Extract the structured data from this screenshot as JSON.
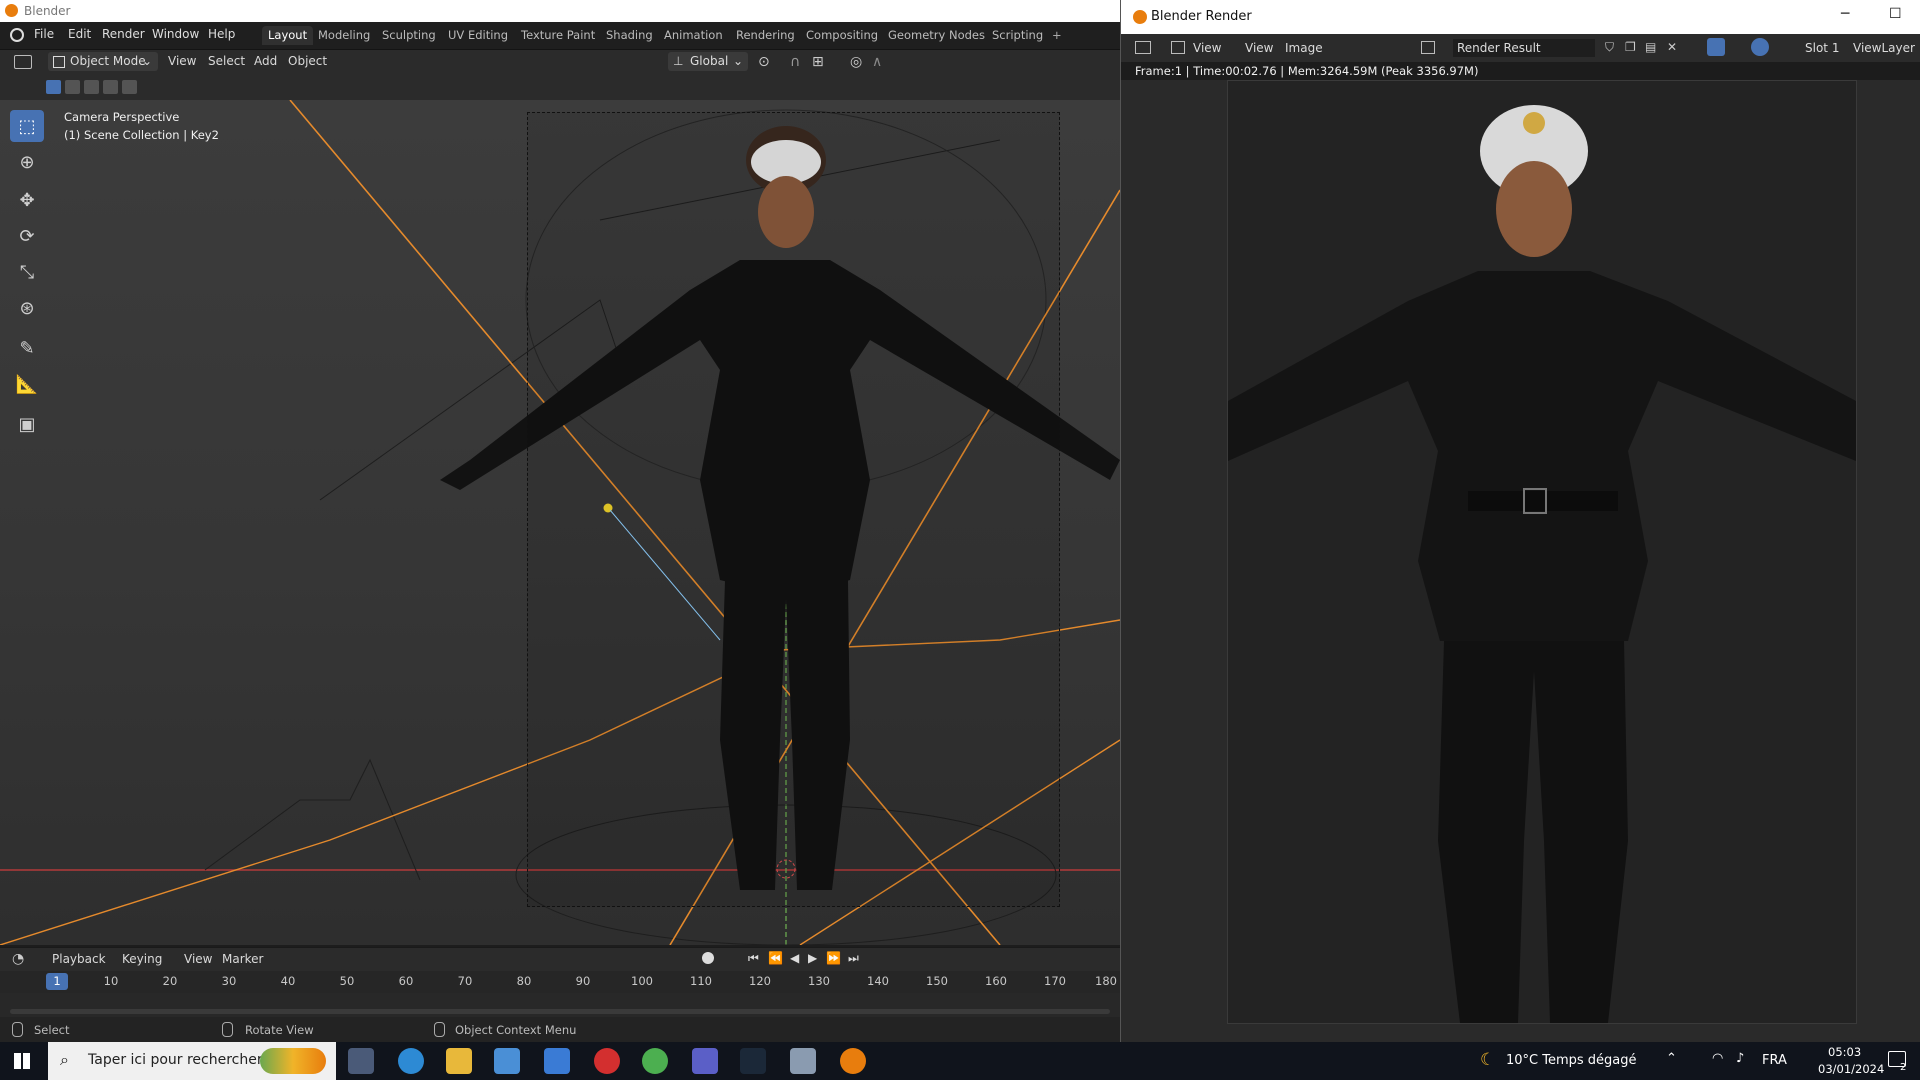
{
  "main_window": {
    "title": "Blender",
    "menu": [
      "File",
      "Edit",
      "Render",
      "Window",
      "Help"
    ],
    "workspace_tabs": [
      "Layout",
      "Modeling",
      "Sculpting",
      "UV Editing",
      "Texture Paint",
      "Shading",
      "Animation",
      "Rendering",
      "Compositing",
      "Geometry Nodes",
      "Scripting"
    ],
    "active_tab": "Layout",
    "add_tab_symbol": "+",
    "header": {
      "mode": "Object Mode",
      "menus": [
        "View",
        "Select",
        "Add",
        "Object"
      ],
      "transform_orientation": "Global"
    },
    "viewport": {
      "info_line1": "Camera Perspective",
      "info_line2": "(1) Scene Collection | Key2"
    },
    "toolbar_icons": [
      "select-box-icon",
      "cursor-icon",
      "move-icon",
      "rotate-icon",
      "scale-icon",
      "transform-icon",
      "annotate-icon",
      "measure-icon",
      "add-cube-icon"
    ],
    "timeline": {
      "menus": [
        "Playback",
        "Keying",
        "View",
        "Marker"
      ],
      "current_frame": "1",
      "ticks": [
        "10",
        "20",
        "30",
        "40",
        "50",
        "60",
        "70",
        "80",
        "90",
        "100",
        "110",
        "120",
        "130",
        "140",
        "150",
        "160",
        "170",
        "180"
      ]
    },
    "statusbar": {
      "left": "Select",
      "middle": "Rotate View",
      "right": "Object Context Menu"
    }
  },
  "render_window": {
    "title": "Blender Render",
    "header": {
      "view_menu": "View",
      "menus": [
        "View",
        "Image"
      ],
      "image_name": "Render Result",
      "slot": "Slot 1",
      "view_layer": "ViewLayer"
    },
    "meta": "Frame:1 | Time:00:02.76 | Mem:3264.59M (Peak 3356.97M)"
  },
  "taskbar": {
    "search_placeholder": "Taper ici pour rechercher",
    "weather": "10°C  Temps dégagé",
    "language": "FRA",
    "time": "05:03",
    "date": "03/01/2024",
    "notification_count": "2"
  },
  "colors": {
    "accent_blue": "#4772b3",
    "camera_orange": "#e58a2c",
    "axis_red": "#b33a3a",
    "axis_green": "#6aa84f"
  }
}
